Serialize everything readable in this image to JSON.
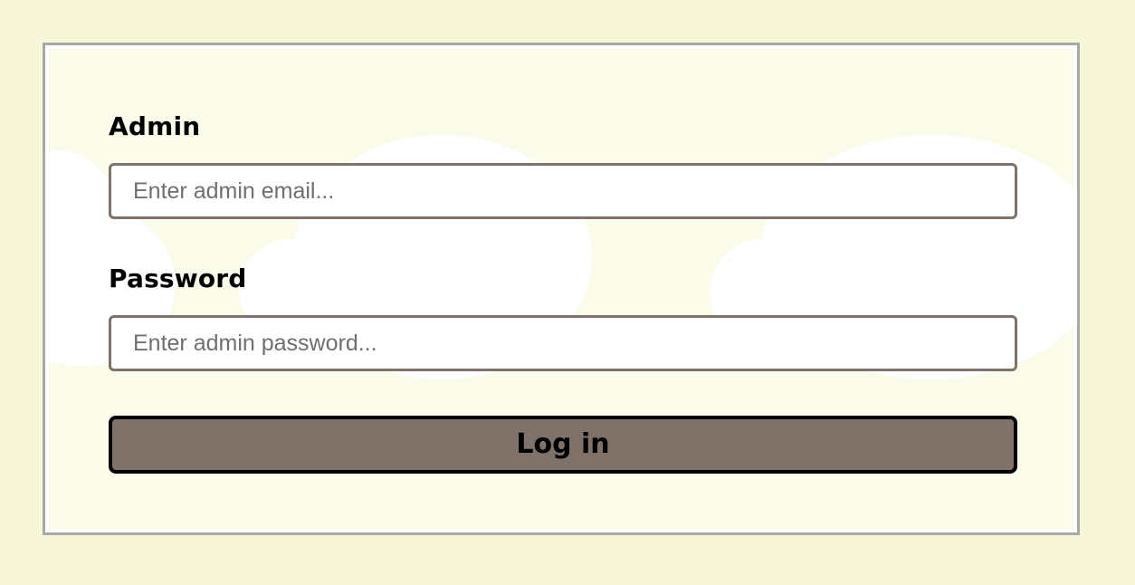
{
  "form": {
    "admin_label": "Admin",
    "admin_placeholder": "Enter admin email...",
    "admin_value": "",
    "password_label": "Password",
    "password_placeholder": "Enter admin password...",
    "password_value": "",
    "login_label": "Log in"
  },
  "colors": {
    "page_background": "#f8f6d8",
    "panel_background": "#fbfbea",
    "input_border": "#7f7268",
    "button_background": "#7f7268",
    "button_border": "#000000",
    "label_text": "#000000"
  }
}
